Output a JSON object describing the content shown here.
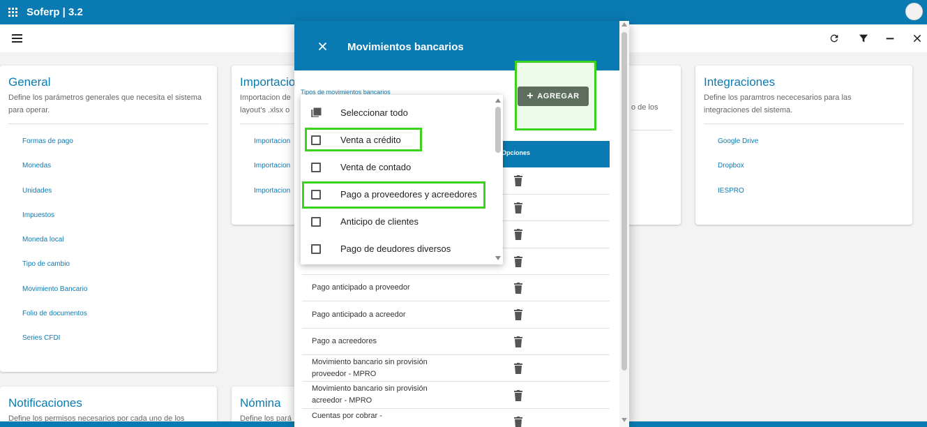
{
  "app": {
    "title": "Soferp | 3.2"
  },
  "colors": {
    "primary": "#0a7bb2",
    "highlight": "#3ad21c",
    "button": "#5d6d5e"
  },
  "toolbar": {
    "icons": [
      "menu-icon",
      "refresh-icon",
      "filter-icon",
      "minimize-icon",
      "close-icon"
    ]
  },
  "cards": {
    "general": {
      "title": "General",
      "desc": "Define los parámetros generales que necesita el sistema para operar.",
      "links": [
        "Formas de pago",
        "Monedas",
        "Unidades",
        "Impuestos",
        "Moneda local",
        "Tipo de cambio",
        "Movimiento Bancario",
        "Folio de documentos",
        "Series CFDI"
      ]
    },
    "importaciones": {
      "title": "Importacio",
      "desc": "Importacion de layout's .xlsx o",
      "links": [
        "Importacion",
        "Importacion",
        "Importacion"
      ]
    },
    "third": {
      "desc": "o de los"
    },
    "integraciones": {
      "title": "Integraciones",
      "desc": "Define los paramtros nececesarios para las integraciones del sistema.",
      "links": [
        "Google Drive",
        "Dropbox",
        "IESPRO"
      ]
    },
    "notificaciones": {
      "title": "Notificaciones",
      "desc": "Define los permisos necesarios por cada uno de los"
    },
    "nomina": {
      "title": "Nómina",
      "desc": "Define los pará"
    }
  },
  "dialog": {
    "title": "Movimientos bancarios",
    "field_label": "Tipos de movimientos bancarios",
    "add_button": "AGREGAR",
    "table_header_options": "Opciones",
    "rows": [
      "",
      "",
      "",
      "",
      "Pago anticipado a proveedor",
      "Pago anticipado a acreedor",
      "Pago a acreedores",
      "Movimiento bancario sin provisión proveedor - MPRO",
      "Movimiento bancario sin provisión acreedor - MPRO",
      "Cuentas por cobrar -"
    ]
  },
  "dropdown": {
    "select_all": "Seleccionar todo",
    "options": [
      {
        "label": "Venta a crédito",
        "checked": false
      },
      {
        "label": "Venta de contado",
        "checked": false
      },
      {
        "label": "Pago a proveedores y acreedores",
        "checked": false
      },
      {
        "label": "Anticipo de clientes",
        "checked": false
      },
      {
        "label": "Pago de deudores diversos",
        "checked": false
      }
    ]
  }
}
